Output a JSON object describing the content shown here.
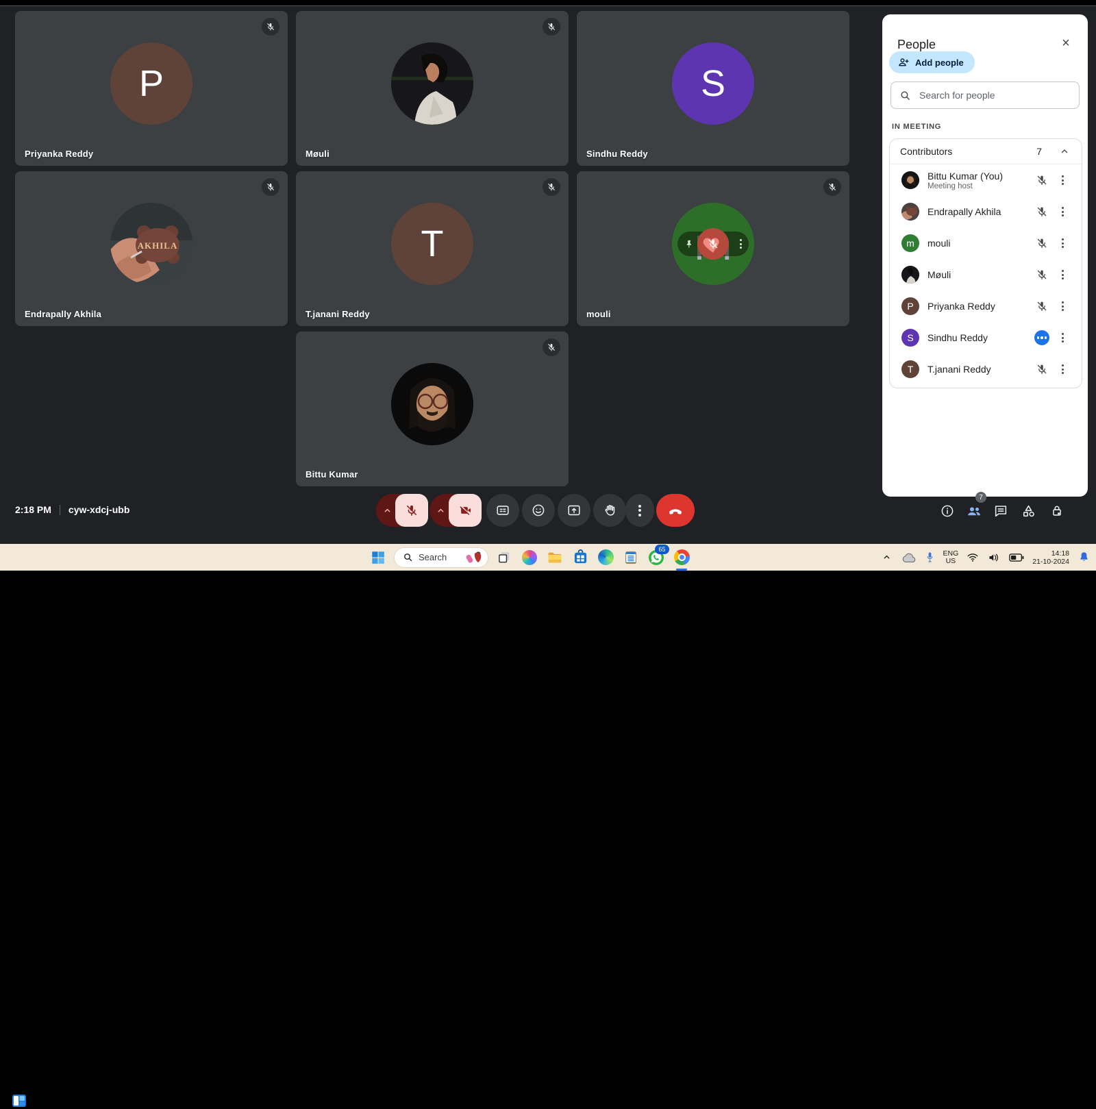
{
  "meeting": {
    "time": "2:18 PM",
    "code": "cyw-xdcj-ubb",
    "tiles": [
      {
        "name": "Priyanka Reddy",
        "avatar_letter": "P",
        "avatar_color": "#5f4339",
        "muted": true
      },
      {
        "name": "Møuli",
        "avatar_photo": "profile-photo",
        "muted": true
      },
      {
        "name": "Sindhu Reddy",
        "avatar_letter": "S",
        "avatar_color": "#5e35b1",
        "muted": false
      },
      {
        "name": "Endrapally Akhila",
        "avatar_photo": "akhila-keychain-photo",
        "muted": true
      },
      {
        "name": "T.janani Reddy",
        "avatar_letter": "T",
        "avatar_color": "#5f4339",
        "muted": true
      },
      {
        "name": "mouli",
        "avatar_letter": "m",
        "avatar_color": "#2d6e28",
        "muted": true
      },
      {
        "name": "Bittu Kumar",
        "avatar_photo": "face-photo",
        "muted": true
      }
    ]
  },
  "panel": {
    "title": "People",
    "close_glyph": "×",
    "add_people_label": "Add people",
    "search_placeholder": "Search for people",
    "section_label": "IN MEETING",
    "group_label": "Contributors",
    "group_count": "7",
    "participants": [
      {
        "name": "Bittu Kumar (You)",
        "subtitle": "Meeting host",
        "avatar_photo": "face-photo",
        "status": "muted"
      },
      {
        "name": "Endrapally Akhila",
        "avatar_photo": "akhila-keychain-photo",
        "status": "muted"
      },
      {
        "name": "mouli",
        "avatar_letter": "m",
        "avatar_color": "#2e7d32",
        "status": "muted"
      },
      {
        "name": "Møuli",
        "avatar_photo": "profile-photo",
        "status": "muted"
      },
      {
        "name": "Priyanka Reddy",
        "avatar_letter": "P",
        "avatar_color": "#5f4339",
        "status": "muted"
      },
      {
        "name": "Sindhu Reddy",
        "avatar_letter": "S",
        "avatar_color": "#5e35b1",
        "status": "speaking"
      },
      {
        "name": "T.janani Reddy",
        "avatar_letter": "T",
        "avatar_color": "#5f4339",
        "status": "muted"
      }
    ]
  },
  "bottom_right": {
    "people_badge": "7"
  },
  "colors": {
    "tile_bg": "#3c4043",
    "panel_bg": "#ffffff",
    "add_people_chip": "#c2e7ff",
    "speaking_badge": "#1a73e8",
    "end_call": "#dc362e",
    "muted_btn_bg": "#f9dedc",
    "muted_btn_icon": "#8c1d18",
    "taskbar_bg": "#f2e9d8"
  },
  "taskbar": {
    "search_placeholder": "Search",
    "whatsapp_badge": "65",
    "tray": {
      "lang_line1": "ENG",
      "lang_line2": "US",
      "time": "14:18",
      "date": "21-10-2024"
    }
  }
}
